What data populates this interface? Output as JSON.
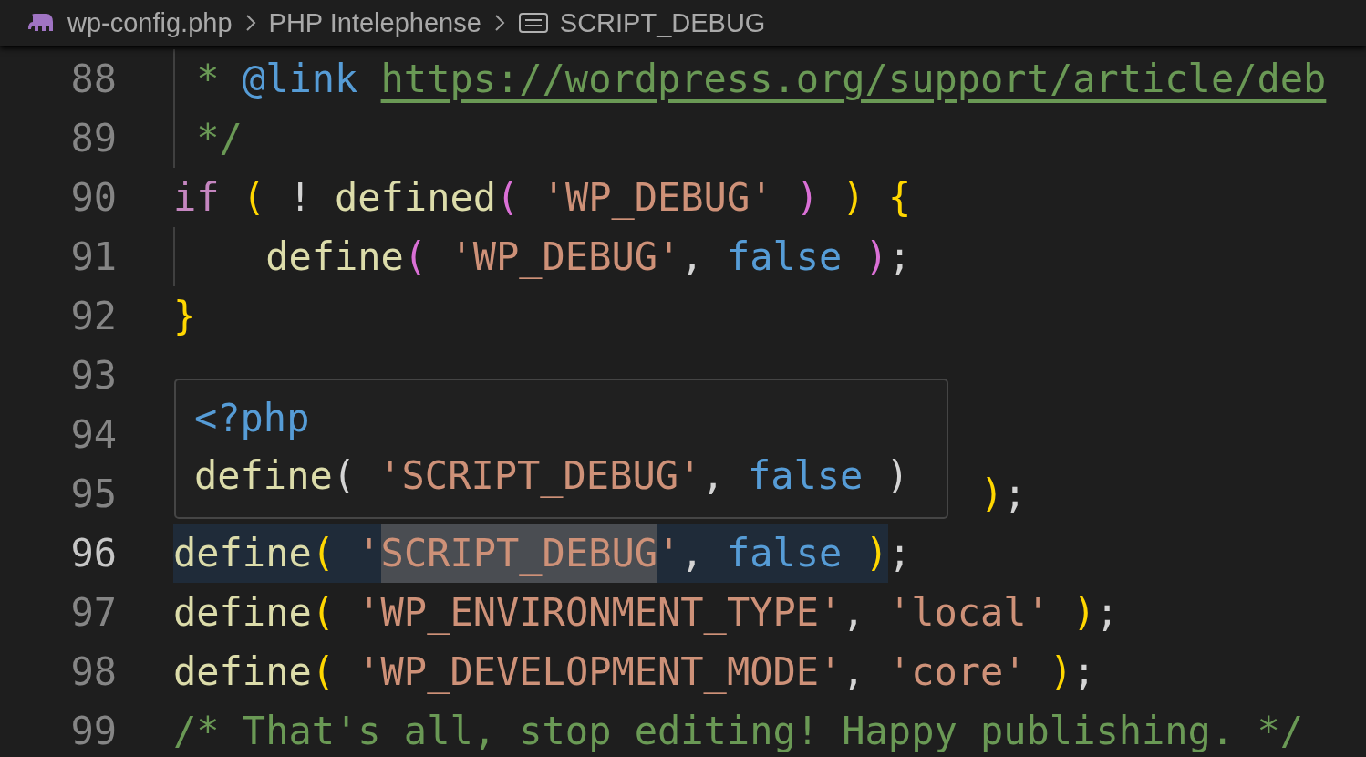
{
  "breadcrumbs": [
    {
      "kind": "file",
      "label": "wp-config.php"
    },
    {
      "kind": "namespace",
      "label": "PHP Intelephense"
    },
    {
      "kind": "constant",
      "label": "SCRIPT_DEBUG"
    }
  ],
  "lines": [
    {
      "number": "88",
      "current": false,
      "tokens": [
        {
          "text": " * ",
          "kind": "comment"
        },
        {
          "text": "@link ",
          "kind": "doctag"
        },
        {
          "text": "https://wordpress.org/support/article/deb",
          "kind": "link"
        }
      ]
    },
    {
      "number": "89",
      "current": false,
      "tokens": [
        {
          "text": " */",
          "kind": "comment"
        }
      ]
    },
    {
      "number": "90",
      "current": false,
      "tokens": [
        {
          "text": "if ",
          "kind": "keyword"
        },
        {
          "text": "( ",
          "kind": "bracket1"
        },
        {
          "text": "! ",
          "kind": "punct"
        },
        {
          "text": "defined",
          "kind": "function"
        },
        {
          "text": "(",
          "kind": "bracket2"
        },
        {
          "text": " 'WP_DEBUG' ",
          "kind": "string"
        },
        {
          "text": ") ",
          "kind": "bracket2"
        },
        {
          "text": ") {",
          "kind": "bracket1"
        }
      ]
    },
    {
      "number": "91",
      "current": false,
      "indented": true,
      "tokens": [
        {
          "text": "define",
          "kind": "function"
        },
        {
          "text": "(",
          "kind": "bracket2"
        },
        {
          "text": " 'WP_DEBUG'",
          "kind": "string"
        },
        {
          "text": ", ",
          "kind": "punct"
        },
        {
          "text": "false ",
          "kind": "constant"
        },
        {
          "text": ")",
          "kind": "bracket2"
        },
        {
          "text": ";",
          "kind": "punct"
        }
      ]
    },
    {
      "number": "92",
      "current": false,
      "tokens": [
        {
          "text": "}",
          "kind": "bracket1"
        }
      ]
    },
    {
      "number": "93",
      "current": false
    },
    {
      "number": "94",
      "current": false
    },
    {
      "number": "95",
      "current": false,
      "covered": true,
      "tokens": [
        {
          "text": ")",
          "kind": "bracket1"
        },
        {
          "text": ";",
          "kind": "punct"
        }
      ]
    },
    {
      "number": "96",
      "current": true,
      "tokens": [
        {
          "text": "define",
          "kind": "function",
          "selected": true
        },
        {
          "text": "(",
          "kind": "bracket1",
          "selected": true
        },
        {
          "text": " '",
          "kind": "string",
          "selected": true
        },
        {
          "text": "SCRIPT_DEBUG",
          "kind": "string",
          "selected": true,
          "occurrence": true
        },
        {
          "text": "'",
          "kind": "string",
          "selected": true
        },
        {
          "text": ", ",
          "kind": "punct",
          "selected": true
        },
        {
          "text": "false ",
          "kind": "constant",
          "selected": true
        },
        {
          "text": ")",
          "kind": "bracket1",
          "selected": true
        },
        {
          "text": ";",
          "kind": "punct",
          "selected": false
        }
      ]
    },
    {
      "number": "97",
      "current": false,
      "tokens": [
        {
          "text": "define",
          "kind": "function"
        },
        {
          "text": "(",
          "kind": "bracket1"
        },
        {
          "text": " 'WP_ENVIRONMENT_TYPE'",
          "kind": "string"
        },
        {
          "text": ", ",
          "kind": "punct"
        },
        {
          "text": "'local' ",
          "kind": "string"
        },
        {
          "text": ")",
          "kind": "bracket1"
        },
        {
          "text": ";",
          "kind": "punct"
        }
      ]
    },
    {
      "number": "98",
      "current": false,
      "tokens": [
        {
          "text": "define",
          "kind": "function"
        },
        {
          "text": "(",
          "kind": "bracket1"
        },
        {
          "text": " 'WP_DEVELOPMENT_MODE'",
          "kind": "string"
        },
        {
          "text": ", ",
          "kind": "punct"
        },
        {
          "text": "'core' ",
          "kind": "string"
        },
        {
          "text": ")",
          "kind": "bracket1"
        },
        {
          "text": ";",
          "kind": "punct"
        }
      ]
    },
    {
      "number": "99",
      "current": false,
      "tokens": [
        {
          "text": "/* That's all, stop editing! Happy publishing. */",
          "kind": "comment"
        }
      ]
    }
  ],
  "hover": {
    "lines": [
      {
        "tokens": [
          {
            "text": "<?php",
            "kind": "constant"
          }
        ]
      },
      {
        "tokens": [
          {
            "text": "define",
            "kind": "function"
          },
          {
            "text": "( ",
            "kind": "punct"
          },
          {
            "text": "'SCRIPT_DEBUG'",
            "kind": "string"
          },
          {
            "text": ", ",
            "kind": "punct"
          },
          {
            "text": "false",
            "kind": "constant"
          },
          {
            "text": " )",
            "kind": "punct"
          }
        ]
      }
    ]
  }
}
